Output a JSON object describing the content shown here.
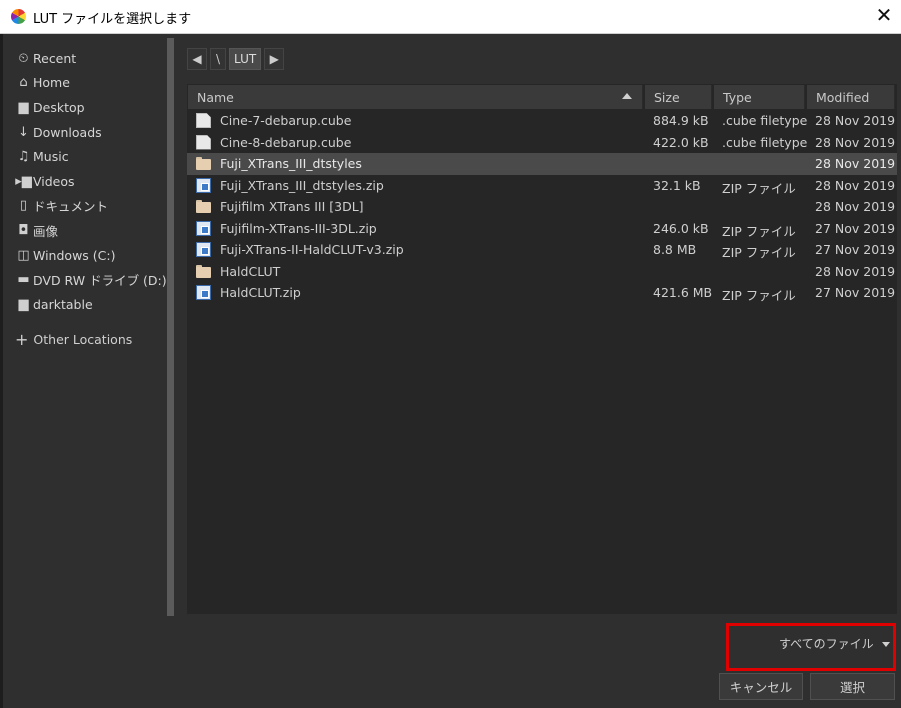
{
  "window": {
    "title": "LUT ファイルを選択します",
    "close_glyph": "✕"
  },
  "sidebar": {
    "places": [
      {
        "label": "Recent",
        "icon": "clock-icon",
        "glyph": "⏲"
      },
      {
        "label": "Home",
        "icon": "home-icon",
        "glyph": "⌂"
      },
      {
        "label": "Desktop",
        "icon": "folder-icon",
        "glyph": "▆"
      },
      {
        "label": "Downloads",
        "icon": "download-icon",
        "glyph": "↓"
      },
      {
        "label": "Music",
        "icon": "music-icon",
        "glyph": "♫"
      },
      {
        "label": "Videos",
        "icon": "video-icon",
        "glyph": "▸▆"
      },
      {
        "label": "ドキュメント",
        "icon": "document-icon",
        "glyph": "▯"
      },
      {
        "label": "画像",
        "icon": "camera-icon",
        "glyph": "◘"
      },
      {
        "label": "Windows (C:)",
        "icon": "drive-icon",
        "glyph": "◫"
      },
      {
        "label": "DVD RW ドライブ (D:)",
        "icon": "optical-drive-icon",
        "glyph": "▬"
      },
      {
        "label": "darktable",
        "icon": "folder-icon",
        "glyph": "▆"
      }
    ],
    "other_locations": "Other Locations",
    "plus_glyph": "+"
  },
  "pathbar": {
    "back": "◀",
    "root": "\\",
    "current": "LUT",
    "forward": "▶"
  },
  "columns": {
    "name": "Name",
    "size": "Size",
    "type": "Type",
    "modified": "Modified"
  },
  "files": [
    {
      "kind": "doc",
      "name": "Cine-7-debarup.cube",
      "size": "884.9 kB",
      "type": ".cube filetype",
      "modified": "28 Nov 2019",
      "selected": false
    },
    {
      "kind": "doc",
      "name": "Cine-8-debarup.cube",
      "size": "422.0 kB",
      "type": ".cube filetype",
      "modified": "28 Nov 2019",
      "selected": false
    },
    {
      "kind": "folder",
      "name": "Fuji_XTrans_III_dtstyles",
      "size": "",
      "type": "",
      "modified": "28 Nov 2019",
      "selected": true
    },
    {
      "kind": "zip",
      "name": "Fuji_XTrans_III_dtstyles.zip",
      "size": "32.1 kB",
      "type": "ZIP ファイル",
      "modified": "28 Nov 2019",
      "selected": false
    },
    {
      "kind": "folder",
      "name": "Fujifilm XTrans III [3DL]",
      "size": "",
      "type": "",
      "modified": "28 Nov 2019",
      "selected": false
    },
    {
      "kind": "zip",
      "name": "Fujifilm-XTrans-III-3DL.zip",
      "size": "246.0 kB",
      "type": "ZIP ファイル",
      "modified": "27 Nov 2019",
      "selected": false
    },
    {
      "kind": "zip",
      "name": "Fuji-XTrans-II-HaldCLUT-v3.zip",
      "size": "8.8 MB",
      "type": "ZIP ファイル",
      "modified": "27 Nov 2019",
      "selected": false
    },
    {
      "kind": "folder",
      "name": "HaldCLUT",
      "size": "",
      "type": "",
      "modified": "28 Nov 2019",
      "selected": false
    },
    {
      "kind": "zip",
      "name": "HaldCLUT.zip",
      "size": "421.6 MB",
      "type": "ZIP ファイル",
      "modified": "27 Nov 2019",
      "selected": false
    }
  ],
  "filter": {
    "value": "すべてのファイル"
  },
  "buttons": {
    "cancel": "キャンセル",
    "select": "選択"
  },
  "colors": {
    "highlight_box": "#e00000",
    "background": "#2f2f2f",
    "file_pane": "#262626",
    "selected_row": "#4a4a4a"
  }
}
